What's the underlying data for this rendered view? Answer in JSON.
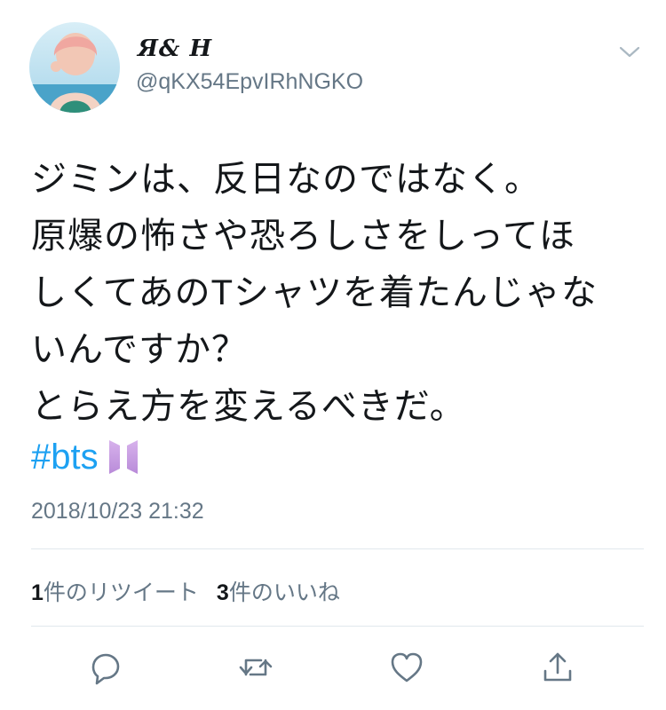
{
  "user": {
    "display_name": "Я& H",
    "handle": "@qKX54EpvIRhNGKO"
  },
  "tweet": {
    "lines": [
      "ジミンは、反日なのではなく。",
      "原爆の怖さや恐ろしさをしってほ",
      "しくてあのTシャツを着たんじゃな",
      "いんですか？",
      "とらえ方を変えるべきだ。"
    ],
    "hashtag": "#bts",
    "timestamp": "2018/10/23 21:32"
  },
  "stats": {
    "retweet_count": "1",
    "retweet_label": "件のリツイート",
    "like_count": "3",
    "like_label": "件のいいね"
  },
  "colors": {
    "text": "#14171a",
    "secondary": "#657786",
    "link": "#1da1f2",
    "divider": "#e1e8ed"
  },
  "icons": [
    "chevron-down-icon",
    "reply-icon",
    "retweet-icon",
    "like-icon",
    "share-icon",
    "bts-logo-emoji"
  ]
}
